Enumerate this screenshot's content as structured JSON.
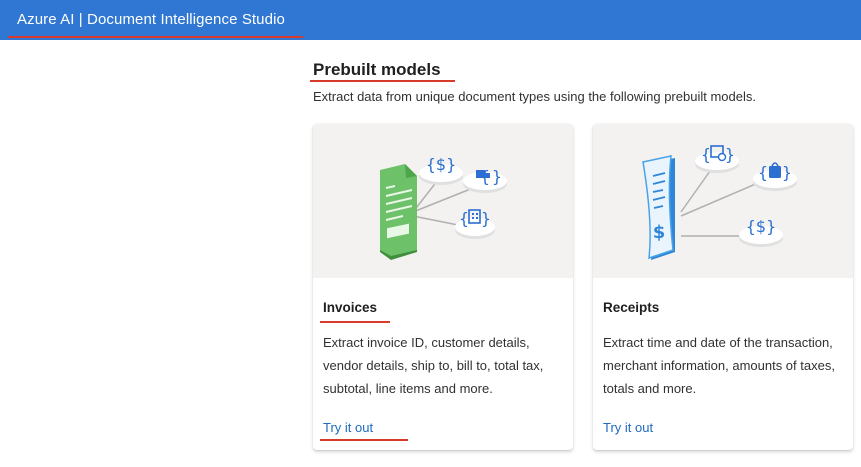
{
  "header": {
    "app_title": "Azure AI | Document Intelligence Studio"
  },
  "main": {
    "section_title": "Prebuilt models",
    "section_subtitle": "Extract data from unique document types using the following prebuilt models.",
    "cards": [
      {
        "title": "Invoices",
        "description": "Extract invoice ID, customer details, vendor details, ship to, bill to, total tax, subtotal, line items and more.",
        "link": "Try it out",
        "illustration_icons": [
          "invoice-document-icon",
          "dollar-braces-icon",
          "truck-braces-icon",
          "building-braces-icon"
        ]
      },
      {
        "title": "Receipts",
        "description": "Extract time and date of the transaction, merchant information, amounts of taxes, totals and more.",
        "link": "Try it out",
        "illustration_icons": [
          "receipt-document-icon",
          "calendar-braces-icon",
          "shopping-bag-braces-icon",
          "dollar-braces-icon"
        ]
      }
    ]
  },
  "colors": {
    "header_bg": "#2f77d2",
    "link": "#1d6ac0",
    "annotation_underline": "#d83b2b",
    "invoice_green": "#5fb35b",
    "receipt_blue": "#4aa3e8"
  }
}
